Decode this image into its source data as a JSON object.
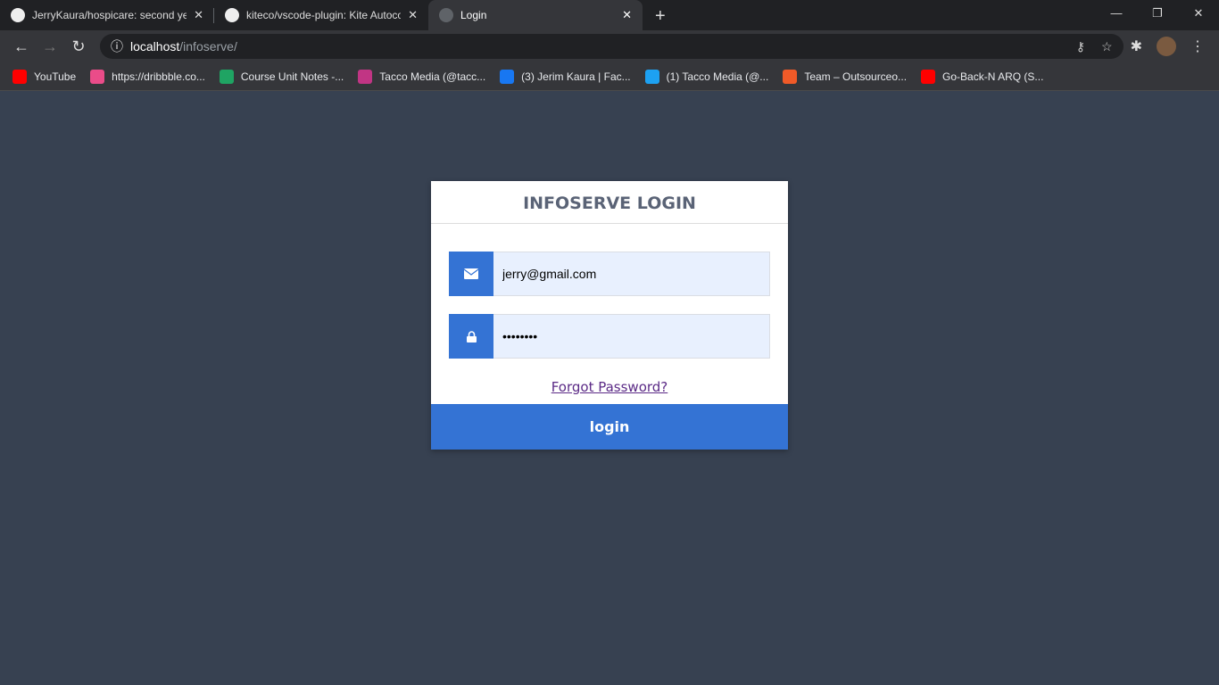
{
  "browser": {
    "tabs": [
      {
        "title": "JerryKaura/hospicare: second year",
        "icon": "github-icon"
      },
      {
        "title": "kiteco/vscode-plugin: Kite Autocomplete",
        "icon": "github-icon"
      },
      {
        "title": "Login",
        "icon": "globe-icon",
        "active": true
      }
    ],
    "url_host": "localhost",
    "url_path": "/infoserve/",
    "bookmarks": [
      {
        "label": "YouTube",
        "color": "#ff0000"
      },
      {
        "label": "https://dribbble.co...",
        "color": "#ea4c89"
      },
      {
        "label": "Course Unit Notes -...",
        "color": "#1fa463"
      },
      {
        "label": "Tacco Media (@tacc...",
        "color": "#c13584"
      },
      {
        "label": "(3) Jerim Kaura | Fac...",
        "color": "#1877f2"
      },
      {
        "label": "(1) Tacco Media (@...",
        "color": "#1da1f2"
      },
      {
        "label": "Team – Outsourceo...",
        "color": "#f05a28"
      },
      {
        "label": "Go-Back-N ARQ (S...",
        "color": "#ff0000"
      }
    ]
  },
  "login": {
    "title": "INFOSERVE LOGIN",
    "email": "jerry@gmail.com",
    "password": "••••••••",
    "forgot": "Forgot Password?",
    "button": "login"
  },
  "colors": {
    "accent": "#3473d4",
    "background": "#374151"
  }
}
